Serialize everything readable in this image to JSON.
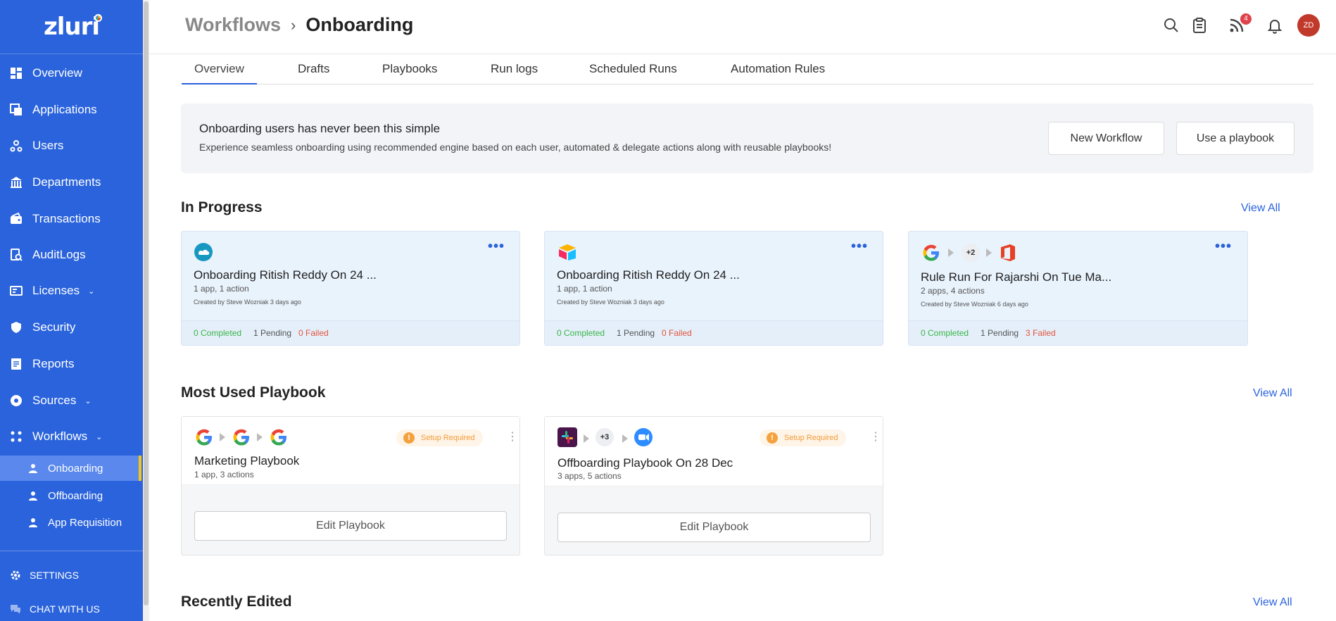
{
  "app": {
    "logo": "zluri"
  },
  "sidebar": {
    "items": [
      {
        "label": "Overview"
      },
      {
        "label": "Applications"
      },
      {
        "label": "Users"
      },
      {
        "label": "Departments"
      },
      {
        "label": "Transactions"
      },
      {
        "label": "AuditLogs"
      },
      {
        "label": "Licenses"
      },
      {
        "label": "Security"
      },
      {
        "label": "Reports"
      },
      {
        "label": "Sources"
      },
      {
        "label": "Workflows"
      }
    ],
    "sub_items": [
      {
        "label": "Onboarding"
      },
      {
        "label": "Offboarding"
      },
      {
        "label": "App Requisition"
      }
    ],
    "settings_label": "SETTINGS",
    "chat_label": "CHAT WITH US"
  },
  "header": {
    "breadcrumb_parent": "Workflows",
    "breadcrumb_current": "Onboarding",
    "notification_count": "4",
    "avatar_initials": "ZD"
  },
  "tabs": [
    {
      "label": "Overview"
    },
    {
      "label": "Drafts"
    },
    {
      "label": "Playbooks"
    },
    {
      "label": "Run logs"
    },
    {
      "label": "Scheduled Runs"
    },
    {
      "label": "Automation Rules"
    }
  ],
  "banner": {
    "title": "Onboarding users has never been this simple",
    "subtitle": "Experience seamless onboarding using recommended engine based on each user, automated & delegate actions along with reusable playbooks!",
    "new_workflow_label": "New Workflow",
    "use_playbook_label": "Use a playbook"
  },
  "in_progress": {
    "title": "In Progress",
    "view_all": "View All",
    "cards": [
      {
        "title": "Onboarding Ritish Reddy On 24 ...",
        "meta": "1 app, 1 action",
        "creator": "Created by Steve Wozniak 3 days ago",
        "completed": "0 Completed",
        "pending": "1 Pending",
        "failed": "0 Failed"
      },
      {
        "title": "Onboarding Ritish Reddy On 24 ...",
        "meta": "1 app, 1 action",
        "creator": "Created by Steve Wozniak 3 days ago",
        "completed": "0 Completed",
        "pending": "1 Pending",
        "failed": "0 Failed"
      },
      {
        "title": "Rule Run For Rajarshi On Tue Ma...",
        "meta": "2 apps, 4 actions",
        "creator": "Created by Steve Wozniak 6 days ago",
        "completed": "0 Completed",
        "pending": "1 Pending",
        "failed": "3 Failed",
        "extra_apps": "+2"
      }
    ]
  },
  "most_used": {
    "title": "Most Used Playbook",
    "view_all": "View All",
    "cards": [
      {
        "title": "Marketing Playbook",
        "meta": "1 app, 3 actions",
        "status": "Setup Required",
        "edit_label": "Edit Playbook"
      },
      {
        "title": "Offboarding Playbook On 28 Dec",
        "meta": "3 apps, 5 actions",
        "status": "Setup Required",
        "edit_label": "Edit Playbook",
        "extra_apps": "+3"
      }
    ]
  },
  "recently_edited": {
    "title": "Recently Edited",
    "view_all": "View All"
  },
  "colors": {
    "sidebar": "#2a63dc",
    "accent": "#2a63dc",
    "success": "#3bb54a",
    "danger": "#e5533d",
    "warning": "#f29c38"
  }
}
